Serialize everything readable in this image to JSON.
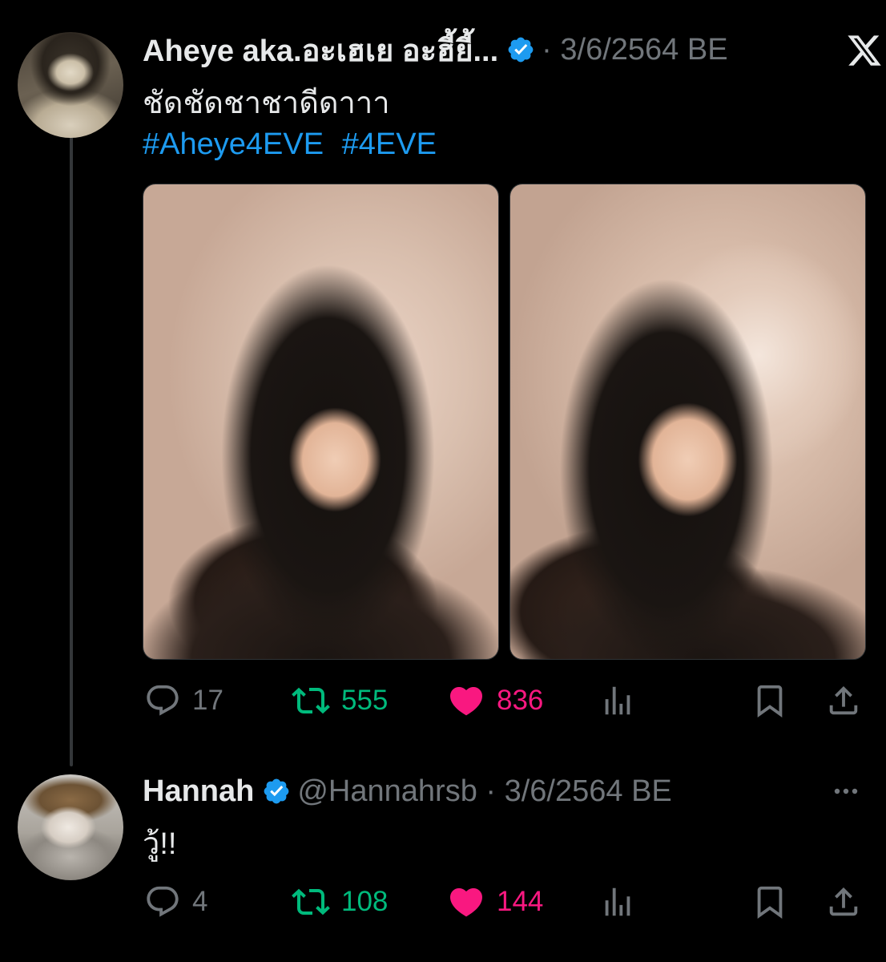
{
  "colors": {
    "background": "#000000",
    "text": "#e7e9ea",
    "muted": "#71767b",
    "link": "#1d9bf0",
    "retweet": "#00ba7c",
    "like": "#f91880",
    "verified": "#1d9bf0"
  },
  "tweets": [
    {
      "display_name": "Aheye aka.อะเฮเย อะฮี้ยี้...",
      "meta": "· 3/6/2564 BE",
      "verified": true,
      "text": "ชัดชัดชาชาดีดาาา",
      "hashtags": [
        "#Aheye4EVE",
        "#4EVE"
      ],
      "media_count": 2,
      "corner_icon": "x-logo-icon",
      "stats": {
        "replies": "17",
        "retweets": "555",
        "likes": "836",
        "retweeted": true,
        "liked": true
      }
    },
    {
      "display_name": "Hannah",
      "meta": "@Hannahrsb · 3/6/2564 BE",
      "verified": true,
      "text": "วู้!!",
      "corner_icon": "more-icon",
      "stats": {
        "replies": "4",
        "retweets": "108",
        "likes": "144",
        "retweeted": true,
        "liked": true
      }
    }
  ],
  "icons": [
    "reply-icon",
    "retweet-icon",
    "like-icon",
    "views-icon",
    "bookmark-icon",
    "share-icon",
    "verified-badge-icon"
  ]
}
